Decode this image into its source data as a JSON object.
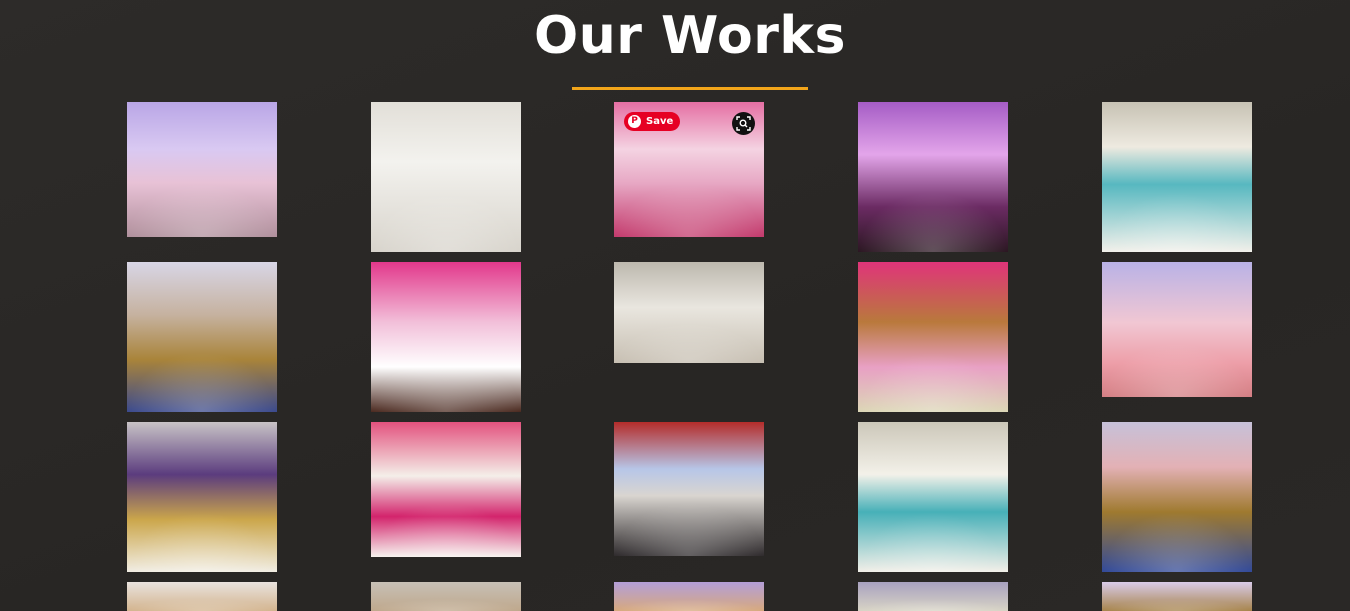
{
  "section": {
    "title": "Our Works",
    "accent_color": "#f2a51a"
  },
  "gallery": {
    "rows": [
      [
        "purple-pink centerpieces",
        "white chairs hall",
        "pink draped hall",
        "magenta lit stage",
        "teal and gold tables"
      ],
      [
        "gold and blue tables",
        "pink arch walkway",
        "white hall overview",
        "pink floral stage",
        "peach tables"
      ],
      [
        "violet stage",
        "pink ribbon chairs",
        "red curtain backdrop",
        "teal and white tables",
        "gold and blue tables"
      ],
      [
        "hall partial",
        "hall partial",
        "hall partial",
        "hall partial",
        "hall partial"
      ]
    ]
  },
  "overlay": {
    "pinterest_save_label": "Save",
    "pinterest_icon": "pinterest-icon",
    "lens_icon": "visual-search-icon"
  }
}
